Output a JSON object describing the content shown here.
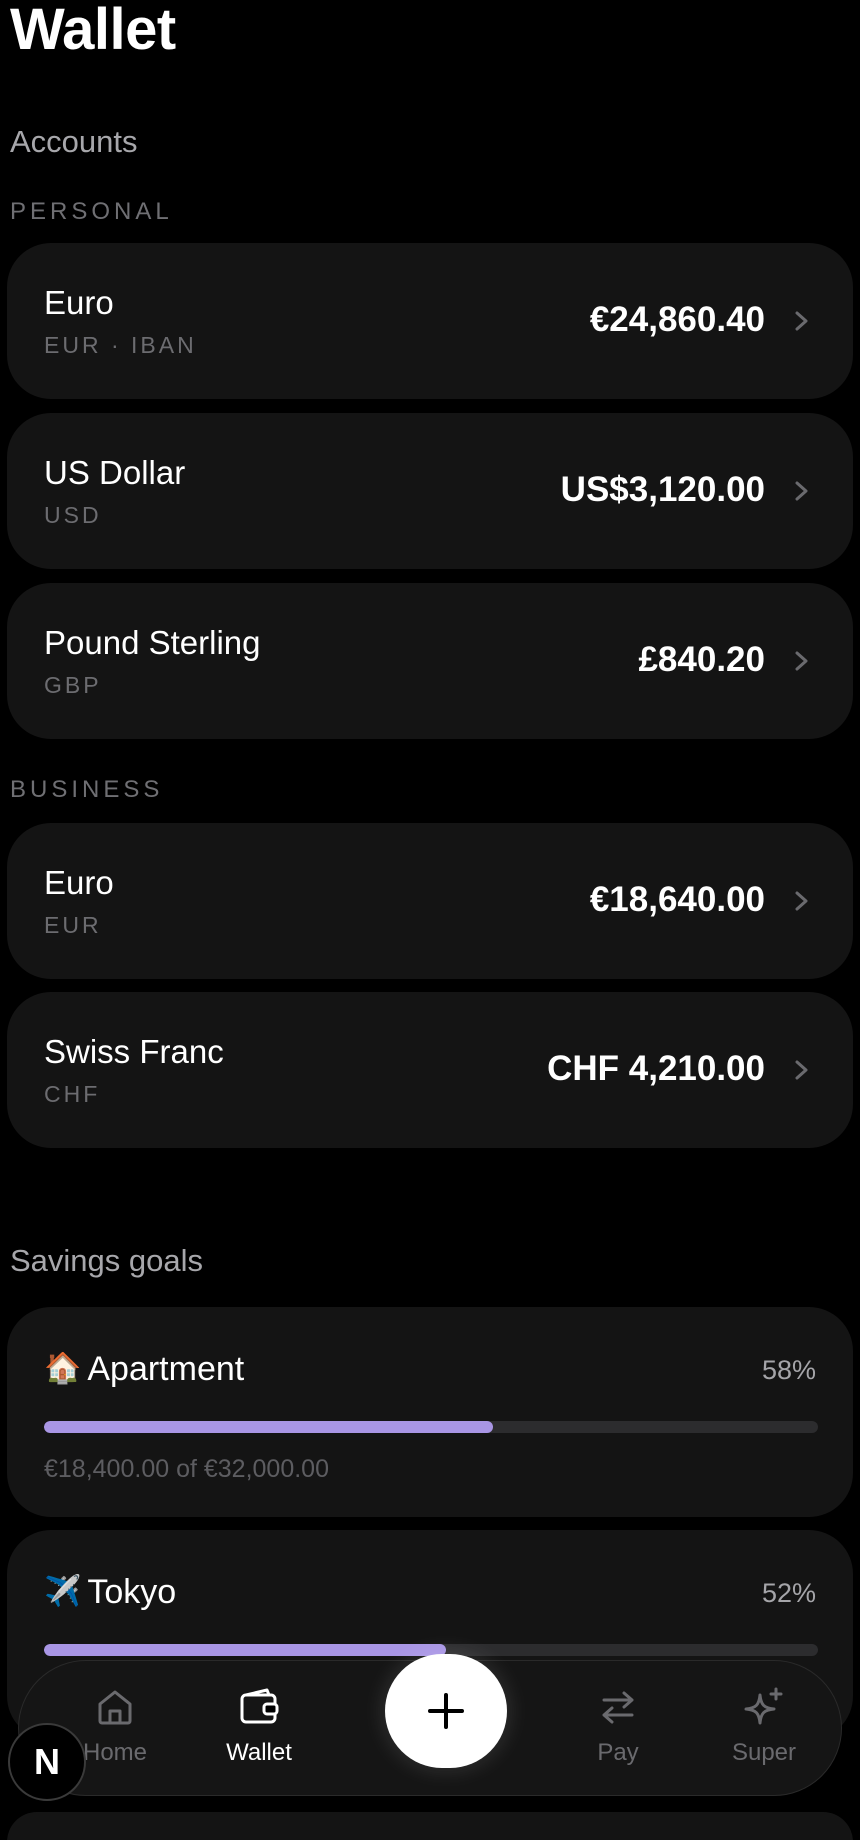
{
  "header": {
    "title": "Wallet"
  },
  "accounts": {
    "title": "Accounts",
    "groups": [
      {
        "label": "PERSONAL",
        "items": [
          {
            "name": "Euro",
            "sub": "EUR · IBAN",
            "balance": "€24,860.40"
          },
          {
            "name": "US Dollar",
            "sub": "USD",
            "balance": "US$3,120.00"
          },
          {
            "name": "Pound Sterling",
            "sub": "GBP",
            "balance": "£840.20"
          }
        ]
      },
      {
        "label": "BUSINESS",
        "items": [
          {
            "name": "Euro",
            "sub": "EUR",
            "balance": "€18,640.00"
          },
          {
            "name": "Swiss Franc",
            "sub": "CHF",
            "balance": "CHF 4,210.00"
          }
        ]
      }
    ]
  },
  "savings": {
    "title": "Savings goals",
    "goals": [
      {
        "emoji": "🏠",
        "name": "Apartment",
        "percent_label": "58%",
        "progress": 0.58,
        "amount": "€18,400.00 of €32,000.00"
      },
      {
        "emoji": "✈️",
        "name": "Tokyo",
        "percent_label": "52%",
        "progress": 0.52
      }
    ]
  },
  "nav": {
    "items": [
      {
        "label": "Home",
        "icon": "home-icon",
        "active": false
      },
      {
        "label": "Wallet",
        "icon": "wallet-icon",
        "active": true
      },
      {
        "label": "Pay",
        "icon": "transfer-arrows-icon",
        "active": false
      },
      {
        "label": "Super",
        "icon": "sparkle-icon",
        "active": false
      }
    ],
    "add_icon": "plus-icon"
  },
  "avatar": {
    "initial": "N"
  },
  "colors": {
    "background": "#000000",
    "card": "#141414",
    "progress_fill": "#a996e5",
    "progress_track": "#2c2c2e",
    "muted_text": "#6c6c70"
  }
}
